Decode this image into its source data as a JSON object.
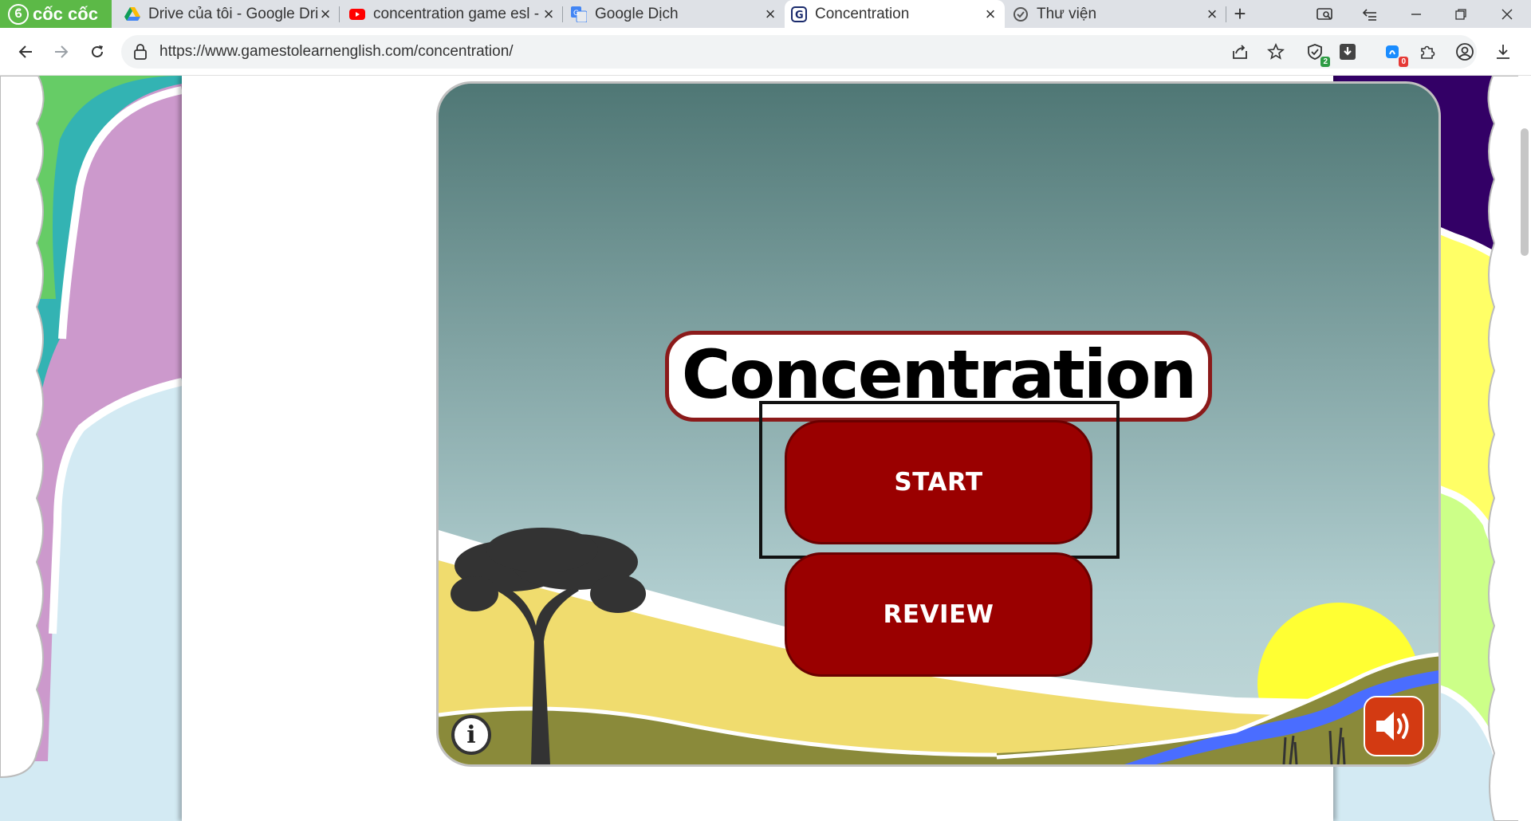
{
  "browser": {
    "brand": "cốc cốc",
    "tabs": [
      {
        "title": "Drive của tôi - Google Drive",
        "icon": "google-drive-icon",
        "active": false
      },
      {
        "title": "concentration game esl - YouTube",
        "icon": "youtube-icon",
        "active": false
      },
      {
        "title": "Google Dịch",
        "icon": "google-translate-icon",
        "active": false
      },
      {
        "title": "Concentration",
        "icon": "gamestolearnenglish-icon",
        "active": true
      },
      {
        "title": "Thư viện",
        "icon": "library-icon",
        "active": false
      }
    ],
    "url": "https://www.gamestolearnenglish.com/concentration/",
    "toolbar_badges": {
      "shield": "2",
      "extension": "0"
    }
  },
  "game": {
    "title": "Concentration",
    "start_label": "START",
    "review_label": "REVIEW",
    "info_label": "i"
  },
  "colors": {
    "button_red": "#9a0000",
    "title_outline": "#8b1a1a",
    "sound_button": "#d33a12",
    "brand_green": "#5cb947",
    "sky_top": "#4f7775",
    "sky_bottom": "#b0cdcf",
    "sun_yellow": "#ffff33"
  }
}
